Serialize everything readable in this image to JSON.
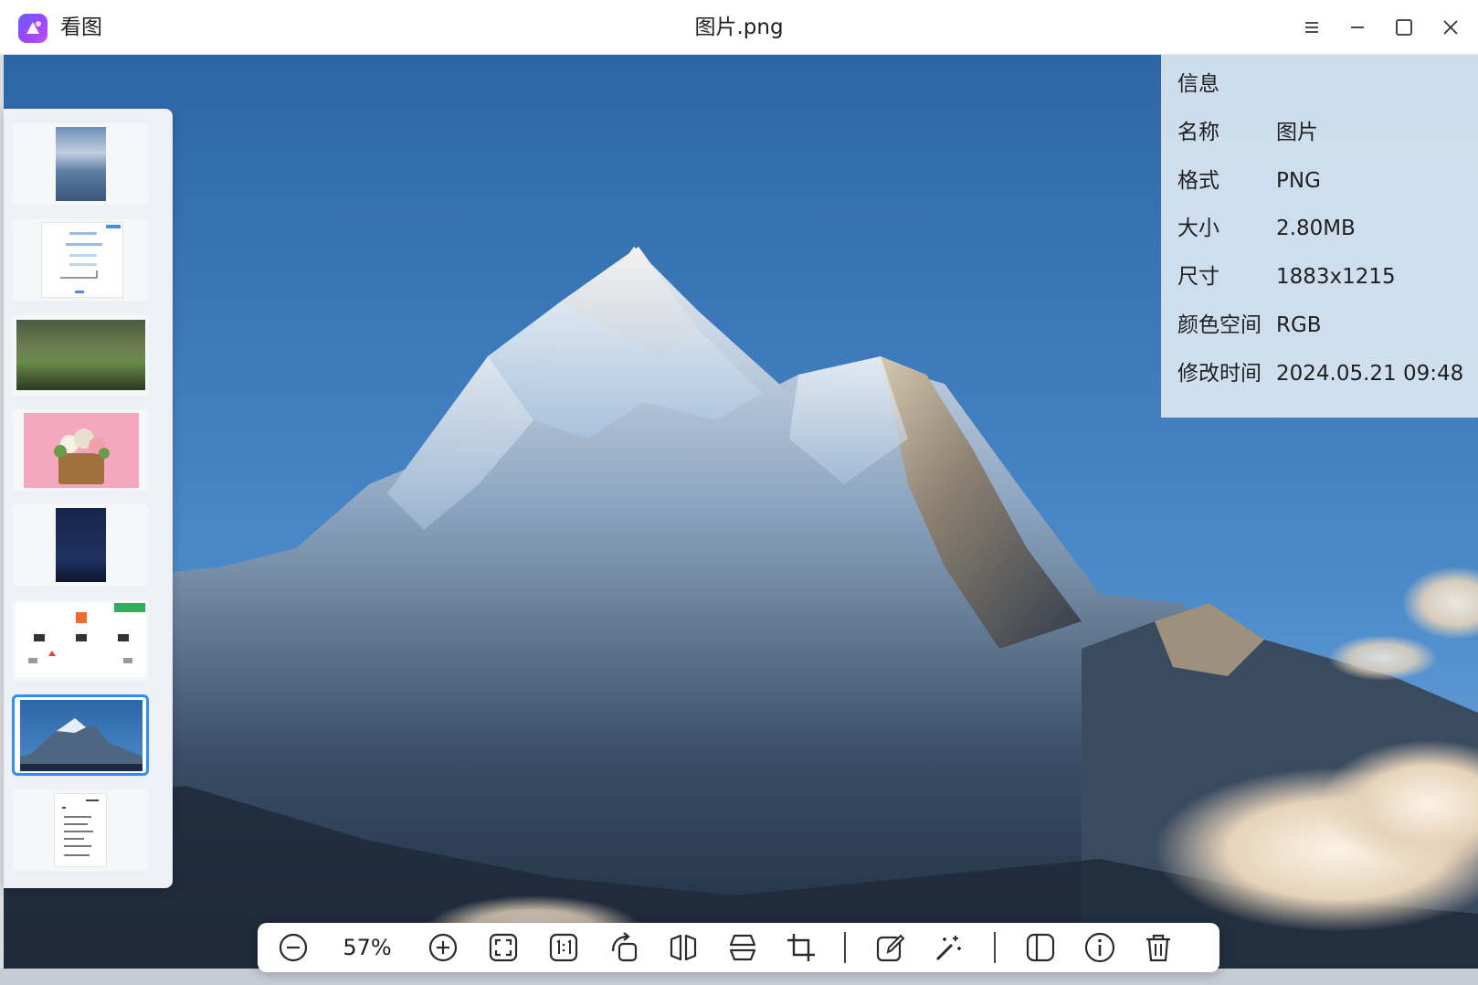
{
  "app": {
    "name": "看图",
    "icon": "image-viewer-logo-icon"
  },
  "window": {
    "title": "图片.png"
  },
  "window_controls": [
    {
      "name": "menu-icon"
    },
    {
      "name": "minimize-icon"
    },
    {
      "name": "maximize-icon"
    },
    {
      "name": "close-icon"
    }
  ],
  "thumbnails": [
    {
      "desc": "coastal-city-photo",
      "active": false
    },
    {
      "desc": "flowchart-document",
      "active": false
    },
    {
      "desc": "forest-lake-photo",
      "active": false
    },
    {
      "desc": "flower-basket-photo",
      "active": false
    },
    {
      "desc": "night-sky-photo",
      "active": false
    },
    {
      "desc": "app-screenshot",
      "active": false
    },
    {
      "desc": "mountain-photo",
      "active": true
    },
    {
      "desc": "text-document",
      "active": false
    }
  ],
  "info": {
    "title": "信息",
    "rows": [
      {
        "key": "名称",
        "value": "图片"
      },
      {
        "key": "格式",
        "value": "PNG"
      },
      {
        "key": "大小",
        "value": "2.80MB"
      },
      {
        "key": "尺寸",
        "value": "1883x1215"
      },
      {
        "key": "颜色空间",
        "value": "RGB"
      },
      {
        "key": "修改时间",
        "value": "2024.05.21 09:48"
      }
    ]
  },
  "toolbar": {
    "zoom_level": "57%",
    "buttons": [
      "zoom-out-icon",
      "zoom-in-icon",
      "fit-window-icon",
      "actual-size-icon",
      "rotate-icon",
      "flip-horizontal-icon",
      "flip-vertical-icon",
      "crop-icon",
      "edit-icon",
      "magic-wand-icon",
      "sidebar-toggle-icon",
      "info-icon",
      "delete-icon"
    ]
  },
  "colors": {
    "accent": "#2f8cff",
    "sky_top": "#2c66a8",
    "sky_bottom": "#5a98d4"
  }
}
